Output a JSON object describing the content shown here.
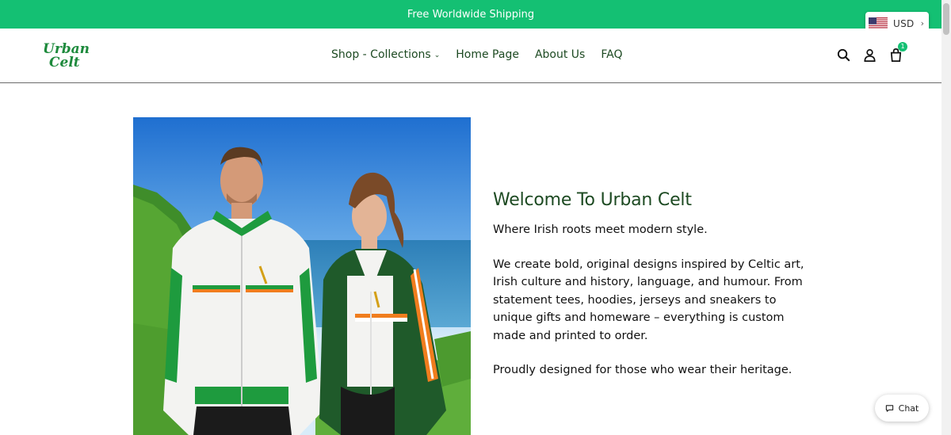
{
  "announcement": {
    "text": "Free Worldwide Shipping"
  },
  "currency": {
    "code": "USD",
    "flag_icon": "us-flag-icon"
  },
  "header": {
    "logo_text": "Urban Celt",
    "brand_color": "#1d8a3c",
    "nav": [
      {
        "label": "Shop - Collections",
        "has_dropdown": true
      },
      {
        "label": "Home Page"
      },
      {
        "label": "About Us"
      },
      {
        "label": "FAQ"
      }
    ],
    "cart_count": "1",
    "icons": [
      "search-icon",
      "account-icon",
      "cart-icon"
    ]
  },
  "hero": {
    "title": "Welcome To Urban Celt",
    "tagline": "Where Irish roots meet modern style.",
    "body": "We create bold, original designs inspired by Celtic art, Irish culture and history, language, and humour. From statement tees, hoodies, jerseys and sneakers to unique gifts and homeware – everything is custom made and printed to order.",
    "closing": "Proudly designed for those who wear their heritage."
  },
  "chat": {
    "label": "Chat"
  },
  "colors": {
    "accent_green": "#14c073",
    "heading_green": "#1d4a22"
  }
}
